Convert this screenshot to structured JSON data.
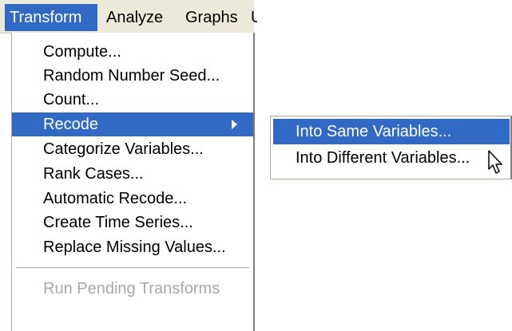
{
  "menubar": {
    "items": [
      {
        "label": "Transform",
        "active": true
      },
      {
        "label": "Analyze",
        "active": false
      },
      {
        "label": "Graphs",
        "active": false
      },
      {
        "label": "U",
        "active": false
      }
    ]
  },
  "transform_menu": {
    "items": [
      {
        "label": "Compute..."
      },
      {
        "label": "Random Number Seed..."
      },
      {
        "label": "Count..."
      },
      {
        "label": "Recode",
        "highlighted": true,
        "has_submenu": true
      },
      {
        "label": "Categorize Variables..."
      },
      {
        "label": "Rank Cases..."
      },
      {
        "label": "Automatic Recode..."
      },
      {
        "label": "Create Time Series..."
      },
      {
        "label": "Replace Missing Values..."
      }
    ],
    "disabled_item": {
      "label": "Run Pending Transforms"
    }
  },
  "recode_submenu": {
    "items": [
      {
        "label": "Into Same Variables...",
        "highlighted": true
      },
      {
        "label": "Into Different Variables..."
      }
    ]
  },
  "colors": {
    "highlight": "#316ac5",
    "menubar_bg": "#ece9d8",
    "disabled_text": "#a8a8a8"
  },
  "cursor": {
    "icon": "mouse-pointer-icon"
  }
}
